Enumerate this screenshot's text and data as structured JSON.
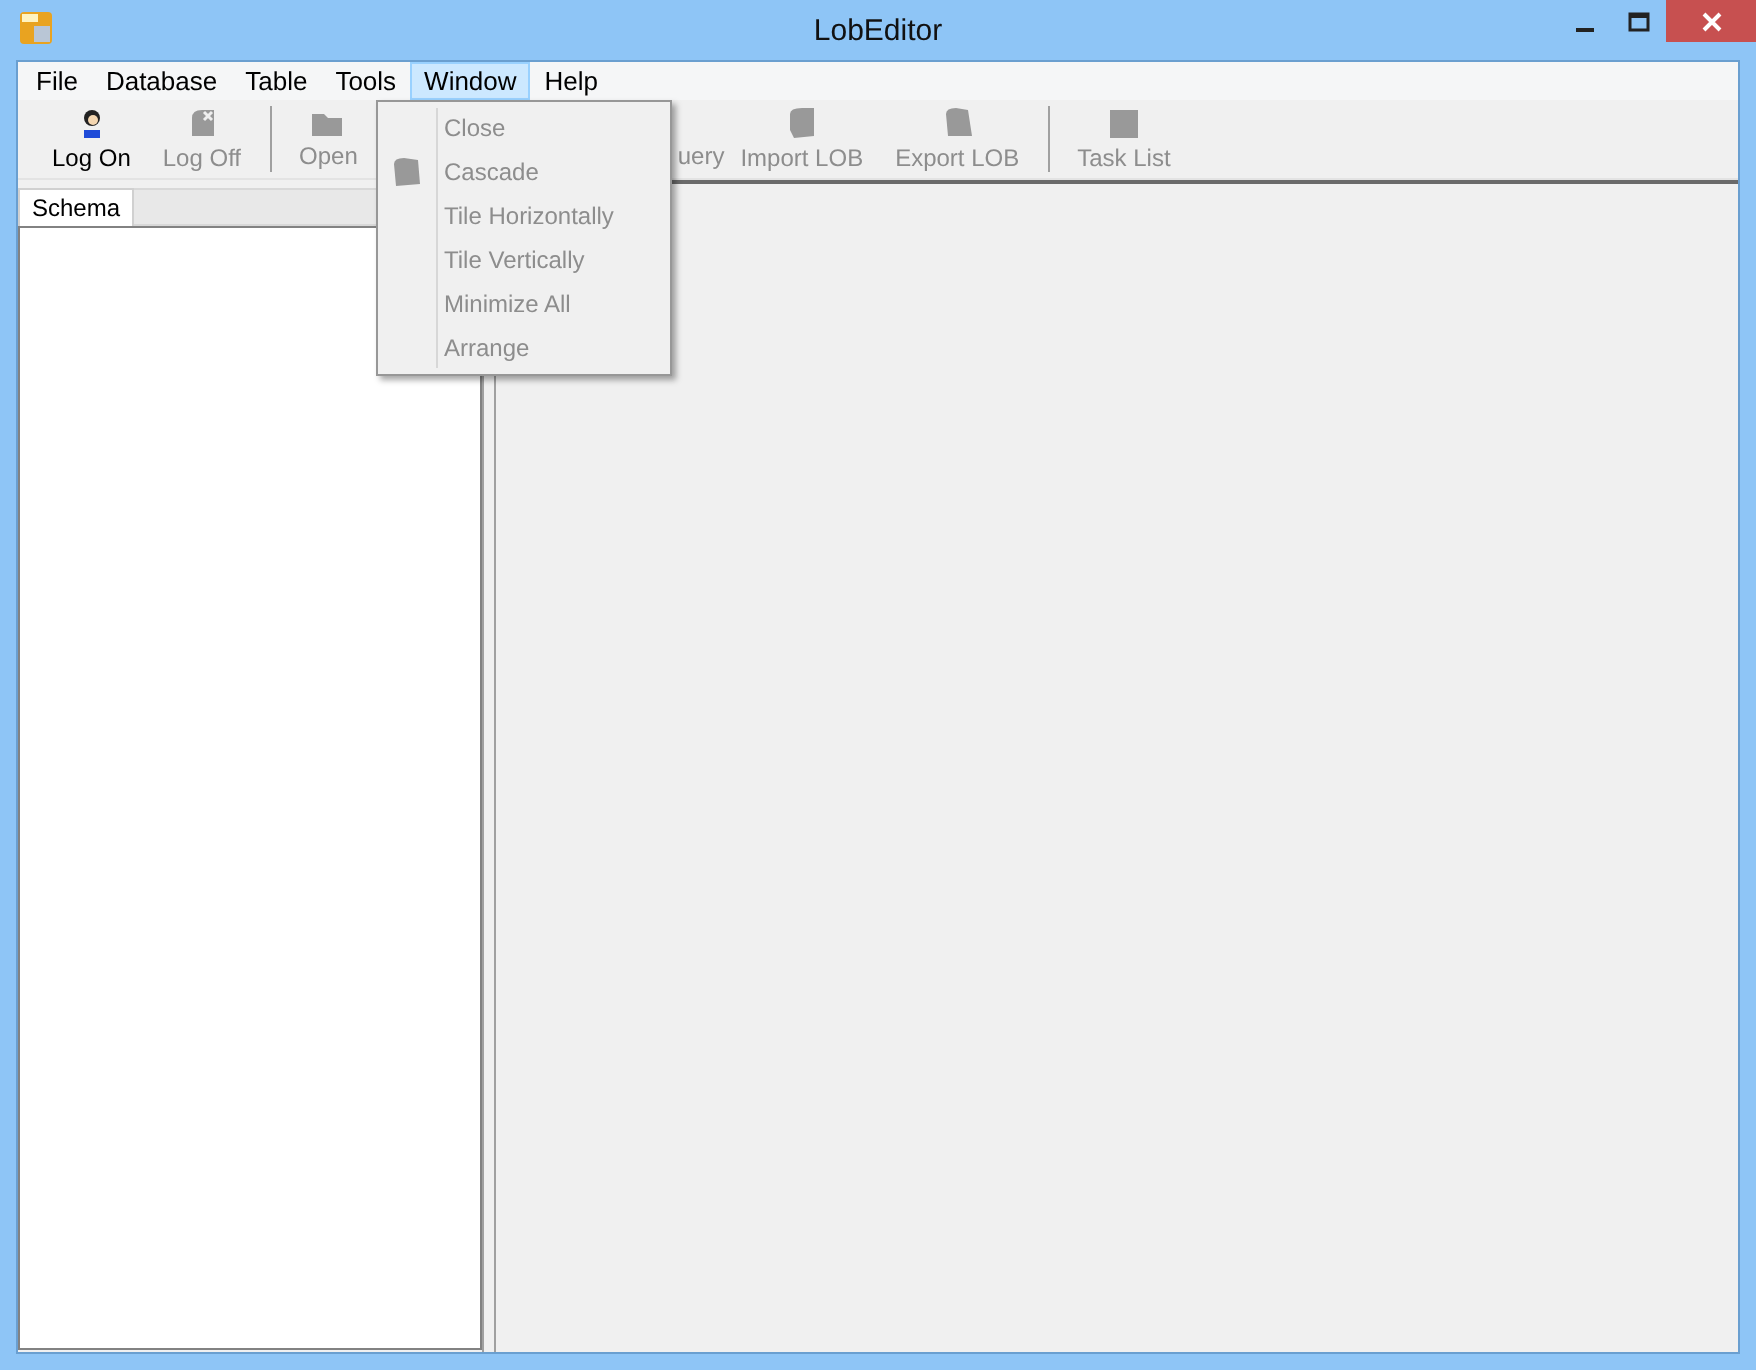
{
  "window": {
    "title": "LobEditor"
  },
  "menu_bar": [
    {
      "label": "File",
      "selected": false
    },
    {
      "label": "Database",
      "selected": false
    },
    {
      "label": "Table",
      "selected": false
    },
    {
      "label": "Tools",
      "selected": false
    },
    {
      "label": "Window",
      "selected": true
    },
    {
      "label": "Help",
      "selected": false
    }
  ],
  "toolbar": [
    {
      "label": "Log On",
      "kind": "user",
      "disabled": false
    },
    {
      "label": "Log Off",
      "kind": "logoff",
      "disabled": true
    },
    {
      "kind": "separator"
    },
    {
      "label": "Open",
      "kind": "folder",
      "disabled": true
    },
    {
      "kind": "hidden"
    },
    {
      "label": "uery",
      "kind": "partial",
      "disabled": true
    },
    {
      "label": "Import LOB",
      "kind": "blob",
      "disabled": true
    },
    {
      "label": "Export LOB",
      "kind": "blob2",
      "disabled": true
    },
    {
      "kind": "separator"
    },
    {
      "label": "Task List",
      "kind": "square",
      "disabled": true
    }
  ],
  "schema_tab": {
    "label": "Schema"
  },
  "window_menu": [
    {
      "label": "Close",
      "disabled": true,
      "icon": false
    },
    {
      "label": "Cascade",
      "disabled": true,
      "icon": true
    },
    {
      "label": "Tile Horizontally",
      "disabled": true,
      "icon": false
    },
    {
      "label": "Tile Vertically",
      "disabled": true,
      "icon": false
    },
    {
      "label": "Minimize All",
      "disabled": true,
      "icon": false
    },
    {
      "label": "Arrange",
      "disabled": true,
      "icon": false
    }
  ]
}
